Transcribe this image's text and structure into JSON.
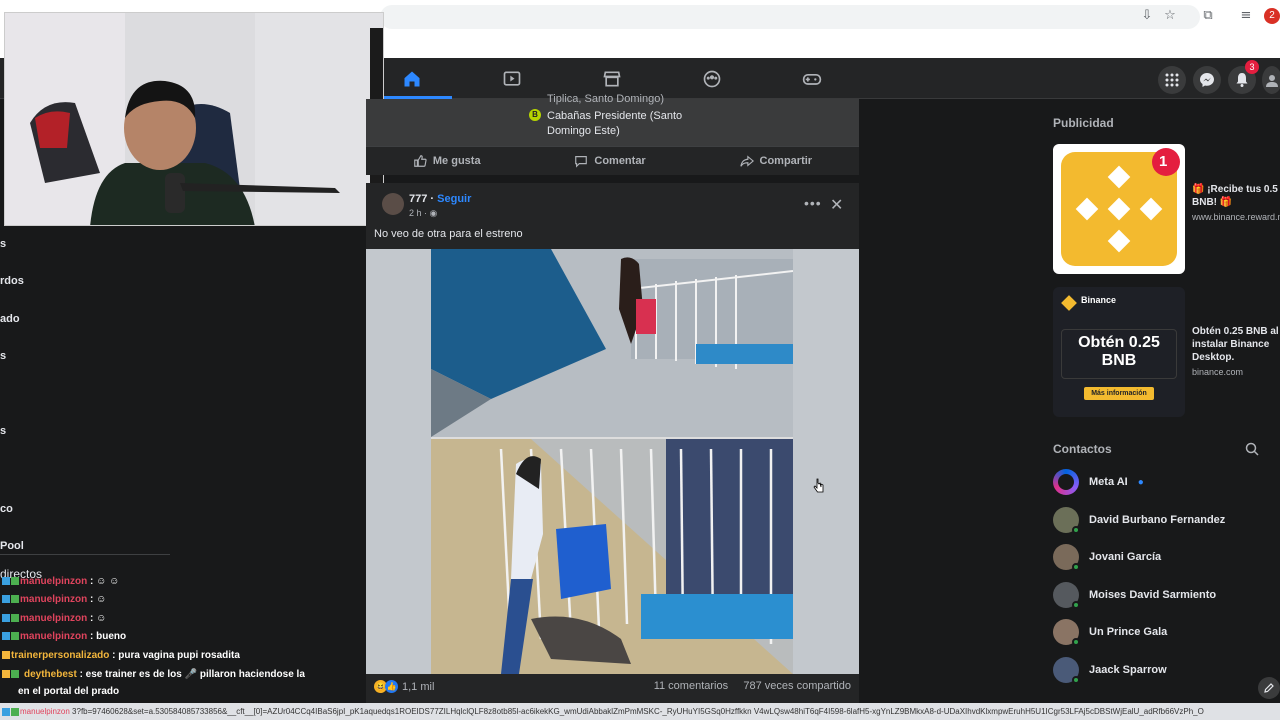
{
  "browser": {
    "profile_badge": "2"
  },
  "nav": {
    "tabs": [
      {
        "name": "home-icon",
        "active": true
      },
      {
        "name": "watch-icon",
        "active": false
      },
      {
        "name": "marketplace-icon",
        "active": false
      },
      {
        "name": "groups-icon",
        "active": false
      },
      {
        "name": "gaming-icon",
        "active": false
      }
    ],
    "notification_count": "3",
    "accent": "#2d88ff"
  },
  "left_sidebar": {
    "items": [
      "s",
      "rdos",
      "ado",
      "s",
      "s"
    ],
    "section": "directos",
    "items2": [
      "co",
      "Pool"
    ]
  },
  "feed": {
    "post1": {
      "location_line1": "Tiplica, Santo Domingo)",
      "location_badge": "B",
      "location_line2": "Cabañas Presidente (Santo Domingo Este)",
      "like": "Me gusta",
      "comment": "Comentar",
      "share": "Compartir"
    },
    "post2": {
      "author": "777",
      "follow": "Seguir",
      "time": "2 h ·",
      "text": "No veo de otra para el estreno",
      "reactions": "1,1 mil",
      "comments": "11 comentarios",
      "shares": "787 veces compartido"
    }
  },
  "right": {
    "ads_title": "Publicidad",
    "ad1": {
      "badge": "1",
      "text": "🎁 ¡Recibe tus 0.5 BNB! 🎁",
      "url": "www.binance.reward.m"
    },
    "ad2": {
      "brand": "Binance",
      "headline": "Obtén 0.25 BNB",
      "cta": "Más información",
      "text": "Obtén 0.25 BNB al instalar Binance Desktop.",
      "url": "binance.com"
    },
    "contacts_title": "Contactos",
    "contacts": [
      {
        "name": "Meta AI",
        "color": "#8a5cf6"
      },
      {
        "name": "David Burbano Fernandez",
        "color": "#6b6f58"
      },
      {
        "name": "Jovani García",
        "color": "#7a6a5a"
      },
      {
        "name": "Moises David Sarmiento",
        "color": "#55595e"
      },
      {
        "name": "Un Prince Gala",
        "color": "#8a7464"
      },
      {
        "name": "Jaack Sparrow",
        "color": "#4a5a78"
      }
    ]
  },
  "chat": [
    {
      "user": "manuelpinzon",
      "msg": ": ☺ ☺"
    },
    {
      "user": "manuelpinzon",
      "msg": ": ☺"
    },
    {
      "user": "manuelpinzon",
      "msg": ": ☺"
    },
    {
      "user": "manuelpinzon",
      "msg": ": bueno"
    },
    {
      "user": "trainerpersonalizado",
      "msg": ": pura vagina pupi rosadita"
    },
    {
      "user": "deythebest",
      "msg": ": ese trainer es de los 🎤 pillaron haciendose la"
    },
    {
      "user": "",
      "msg": "en el portal del prado"
    },
    {
      "user": "manuelpinzon",
      "msg": ""
    }
  ],
  "statusbar": "3?fb=97460628&set=a.530584085733856&__cft__[0]=AZUr04CCq4IBaS6jpI_pK1aquedqs1ROEIDS77ZILHqlclQLF8z8otb85l-ac6ikekKG_wmUdiAbbaklZmPmMSKC-_RyUHuYI5GSq0Hzffkkn V4wLQsw48hiT6qF4I598-6lafH5-xgYnLZ9BMkxA8-d-UDaXIhvdKlxmpwEruhH5U1ICgr53LFAj5cDBStWjEalU_adRfb66VzPh_O"
}
